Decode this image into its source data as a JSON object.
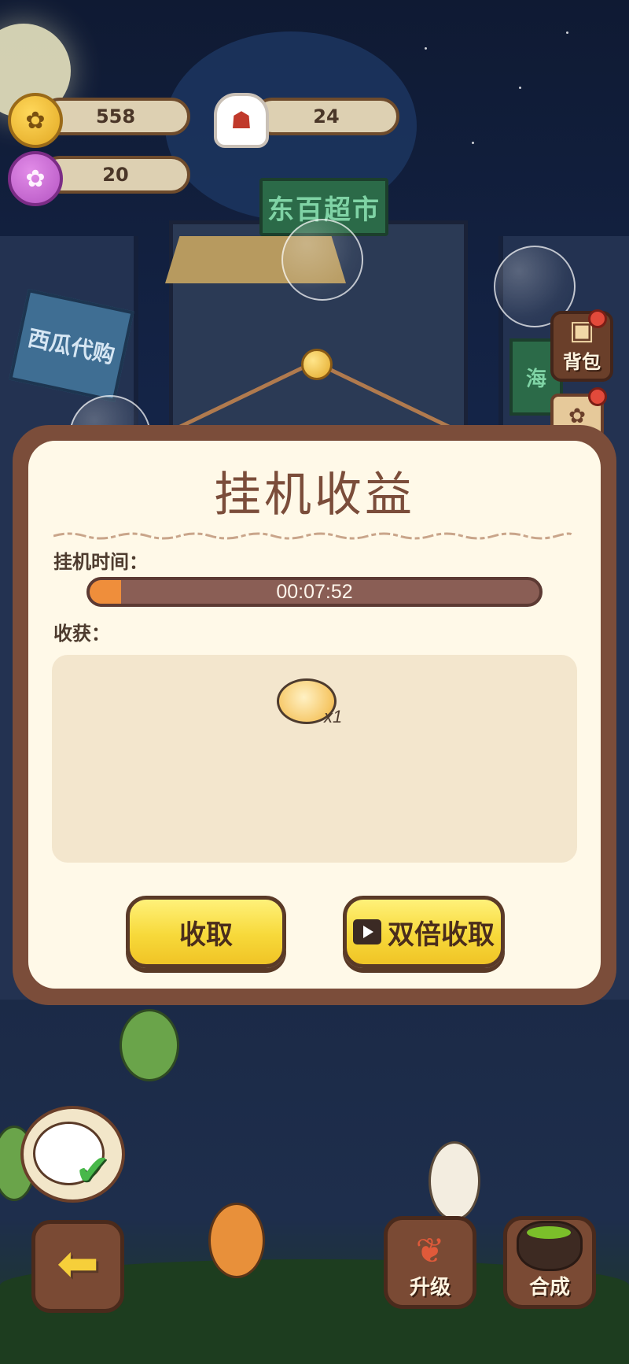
{
  "scene": {
    "shop_sign": "东百超市",
    "left_sign": "西瓜代购",
    "right_sign": "海"
  },
  "resources": {
    "coins": "558",
    "chef_hats": "24",
    "paws": "20"
  },
  "side_buttons": {
    "bag_label": "背包"
  },
  "dialog": {
    "title": "挂机收益",
    "idle_time_label": "挂机时间：",
    "idle_time_value": "00:07:52",
    "progress_fraction": 0.07,
    "harvest_label": "收获：",
    "reward_quantity": "x1",
    "collect_label": "收取",
    "double_collect_label": "双倍收取"
  },
  "bottom_buttons": {
    "upgrade_label": "升级",
    "merge_label": "合成"
  },
  "colors": {
    "dialog_border": "#7b4d3a",
    "dialog_bg": "#fff9e8",
    "button_yellow": "#f7d93a",
    "progress_fill": "#ef8e3b"
  }
}
